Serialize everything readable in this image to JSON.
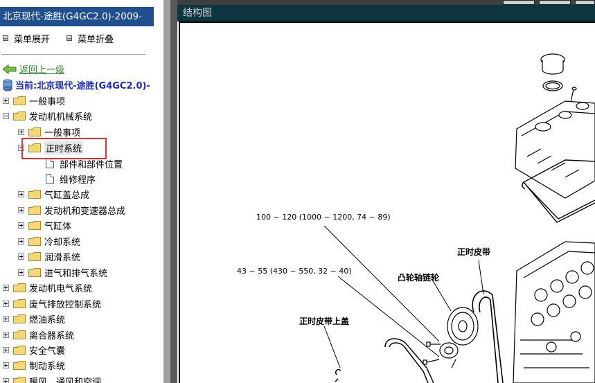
{
  "window": {
    "title": "北京现代-途胜(G4GC2.0)-2009-"
  },
  "menu": {
    "expand_label": "菜单展开",
    "collapse_label": "菜单折叠"
  },
  "nav": {
    "back_label": "返回上一级",
    "current_label": "当前:北京现代-途胜(G4GC2.0)-"
  },
  "tree": {
    "general": "一般事项",
    "engine_mech": "发动机机械系统",
    "children": {
      "general": "一般事项",
      "timing": "正时系统",
      "timing_children": [
        "部件和部件位置",
        "维修程序"
      ],
      "cylinder_head": "气缸盖总成",
      "engine_trans": "发动机和变速器总成",
      "cylinder_block": "气缸体",
      "cooling": "冷却系统",
      "lubrication": "润滑系统",
      "intake_exhaust": "进气和排气系统"
    },
    "engine_electrical": "发动机电气系统",
    "emission": "废气排放控制系统",
    "fuel": "燃油系统",
    "clutch": "离合器系统",
    "airbag": "安全气囊",
    "brake": "制动系统",
    "hvac": "暖风、通风和空调"
  },
  "diagram": {
    "header": "结构图",
    "torque_1": "100 ~ 120 (1000 ~ 1200, 74 ~ 89)",
    "torque_2": "43 ~ 55 (430 ~ 550, 32 ~ 40)",
    "timing_belt": "正时皮带",
    "camshaft_sprocket": "凸轮轴链轮",
    "timing_belt_upper_cover": "正时皮带上盖"
  },
  "colors": {
    "title_bar_bg": "#1f4f8f",
    "header_bg": "#0c3540",
    "highlight_border": "#e03030",
    "back_link": "#2a8a2a",
    "current_text": "#1a28c8"
  }
}
